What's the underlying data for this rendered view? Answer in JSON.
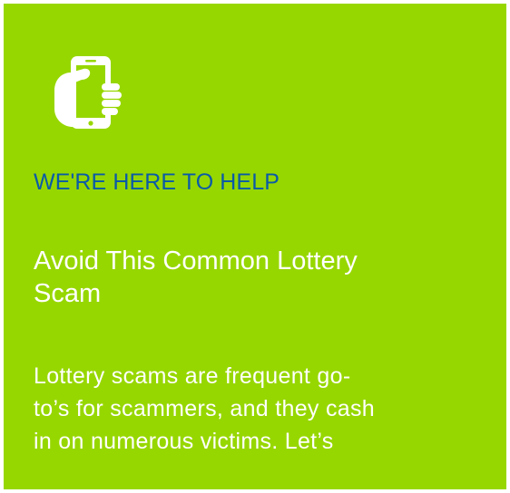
{
  "card": {
    "background_color": "#97d700",
    "icon": "hand-holding-phone-icon",
    "eyebrow": "WE'RE HERE TO HELP",
    "eyebrow_color": "#0a5aa8",
    "headline_lines": [
      "Avoid This Common Lottery",
      "Scam"
    ],
    "body_lines": [
      "Lottery scams are frequent go-",
      "to’s for scammers, and they cash",
      "in on numerous victims. Let’s"
    ]
  }
}
